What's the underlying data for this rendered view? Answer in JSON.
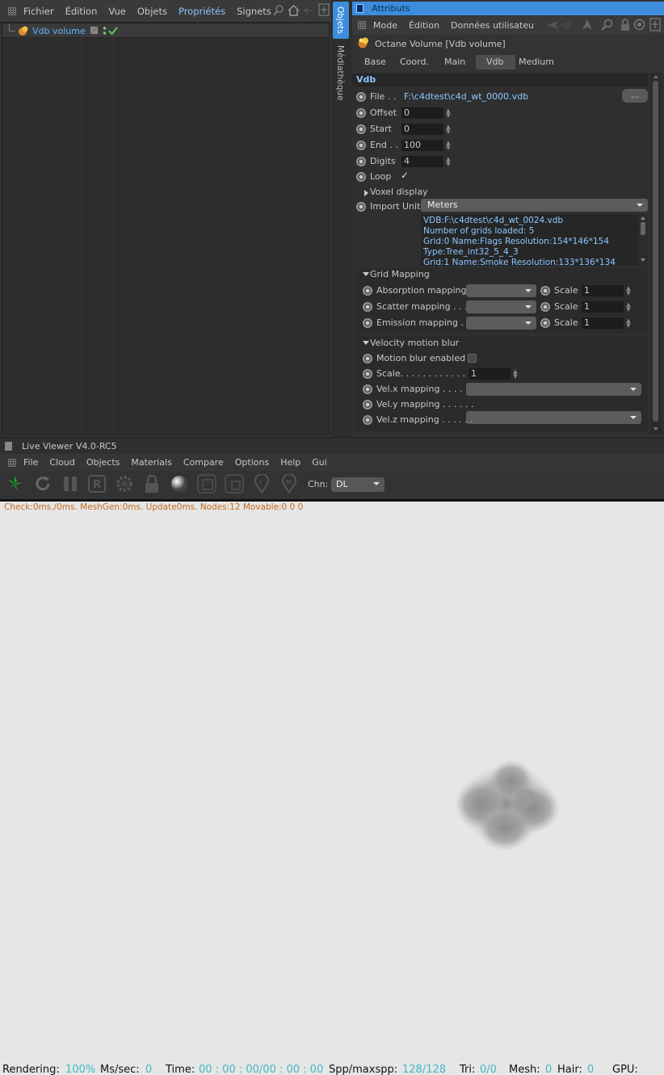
{
  "obj_panel": {
    "menu": [
      "Fichier",
      "Édition",
      "Vue",
      "Objets",
      "Propriétés",
      "Signets"
    ],
    "item_name": "Vdb volume",
    "side_tabs": [
      "Objets",
      "Médiathèque"
    ]
  },
  "attr": {
    "title": "Attributs",
    "menu": [
      "Mode",
      "Édition",
      "Données utilisateu"
    ],
    "object_title": "Octane Volume [Vdb volume]",
    "tabs": [
      "Base",
      "Coord.",
      "Main",
      "Vdb",
      "Medium"
    ],
    "active_tab": "Vdb",
    "section": "Vdb",
    "file_label": "File . .",
    "file_value": "F:\\c4dtest\\c4d_wt_0000.vdb",
    "browse_label": "...",
    "fields": [
      {
        "label": "Offset",
        "value": "0"
      },
      {
        "label": "Start",
        "value": "0"
      },
      {
        "label": "End . .",
        "value": "100"
      },
      {
        "label": "Digits",
        "value": "4"
      }
    ],
    "loop_label": "Loop",
    "loop_check": "✓",
    "voxel_label": "Voxel display",
    "import_label": "Import Unit",
    "import_value": "Meters",
    "info_lines": [
      "VDB:F:\\c4dtest\\c4d_wt_0024.vdb",
      "Number of grids loaded: 5",
      "Grid:0  Name:Flags  Resolution:154*146*154",
      "Type:Tree_int32_5_4_3",
      "Grid:1  Name:Smoke  Resolution:133*136*134"
    ],
    "grid_mapping": {
      "title": "Grid Mapping",
      "rows": [
        {
          "label": "Absorption mapping",
          "scale_label": "Scale",
          "scale": "1"
        },
        {
          "label": "Scatter mapping . . . .",
          "scale_label": "Scale",
          "scale": "1"
        },
        {
          "label": "Emission mapping  . .",
          "scale_label": "Scale",
          "scale": "1"
        }
      ]
    },
    "velocity": {
      "title": "Velocity motion blur",
      "enabled_label": "Motion blur enabled",
      "scale_label": "Scale. . . . . . . . . . . . . .",
      "scale_value": "1",
      "maps": [
        "Vel.x mapping . . . . . .",
        "Vel.y mapping . . . . . .",
        "Vel.z mapping . . . . . ."
      ]
    }
  },
  "viewer": {
    "title": "Live Viewer V4.0-RC5",
    "menu": [
      "File",
      "Cloud",
      "Objects",
      "Materials",
      "Compare",
      "Options",
      "Help",
      "Gui"
    ],
    "chn_label": "Chn:",
    "chn_value": "DL",
    "status_line": "Check:0ms./0ms. MeshGen:0ms. Update0ms. Nodes:12 Movable:0  0 0",
    "bottom": {
      "rendering_label": "Rendering:",
      "rendering": "100%",
      "mssec_label": "Ms/sec:",
      "mssec": "0",
      "time_label": "Time:",
      "time": "00 : 00 : 00/00 : 00 : 00",
      "spp_label": "Spp/maxspp:",
      "spp": "128/128",
      "tri_label": "Tri:",
      "tri": "0/0",
      "mesh_label": "Mesh:",
      "mesh": "0",
      "hair_label": "Hair:",
      "hair": "0",
      "gpu_label": "GPU:"
    }
  },
  "colors": {
    "accent": "#3c8ddb",
    "highlight_text": "#8cc7ff",
    "status_orange": "#c46a1a",
    "status_value": "#3fb9c5",
    "canvas": "#e6e6e6"
  }
}
